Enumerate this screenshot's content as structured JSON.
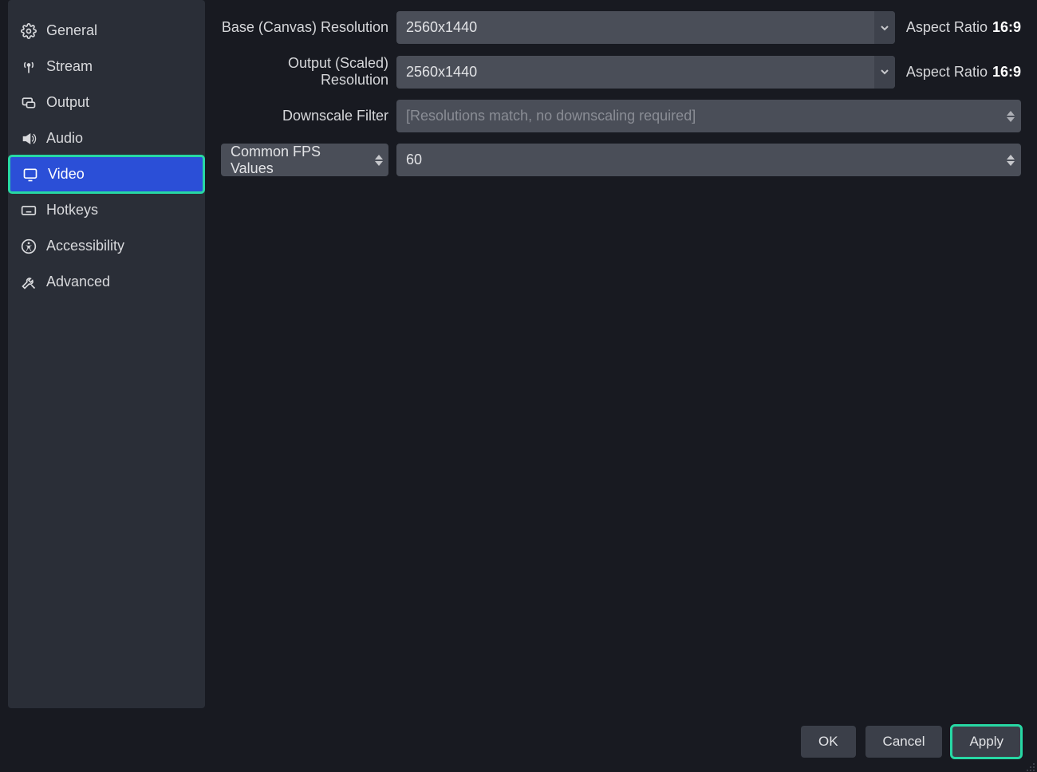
{
  "sidebar": {
    "items": [
      {
        "label": "General",
        "icon": "gear-icon"
      },
      {
        "label": "Stream",
        "icon": "antenna-icon"
      },
      {
        "label": "Output",
        "icon": "output-icon"
      },
      {
        "label": "Audio",
        "icon": "speaker-icon"
      },
      {
        "label": "Video",
        "icon": "monitor-icon",
        "selected": true,
        "highlighted": true
      },
      {
        "label": "Hotkeys",
        "icon": "keyboard-icon"
      },
      {
        "label": "Accessibility",
        "icon": "accessibility-icon"
      },
      {
        "label": "Advanced",
        "icon": "tools-icon"
      }
    ]
  },
  "video_settings": {
    "base_resolution": {
      "label": "Base (Canvas) Resolution",
      "value": "2560x1440"
    },
    "output_resolution": {
      "label": "Output (Scaled) Resolution",
      "value": "2560x1440"
    },
    "downscale_filter": {
      "label": "Downscale Filter",
      "value": "[Resolutions match, no downscaling required]"
    },
    "fps_mode": {
      "label": "Common FPS Values"
    },
    "fps_value": {
      "value": "60"
    },
    "aspect_label": "Aspect Ratio",
    "aspect_value": "16:9"
  },
  "footer": {
    "ok": "OK",
    "cancel": "Cancel",
    "apply": "Apply"
  }
}
